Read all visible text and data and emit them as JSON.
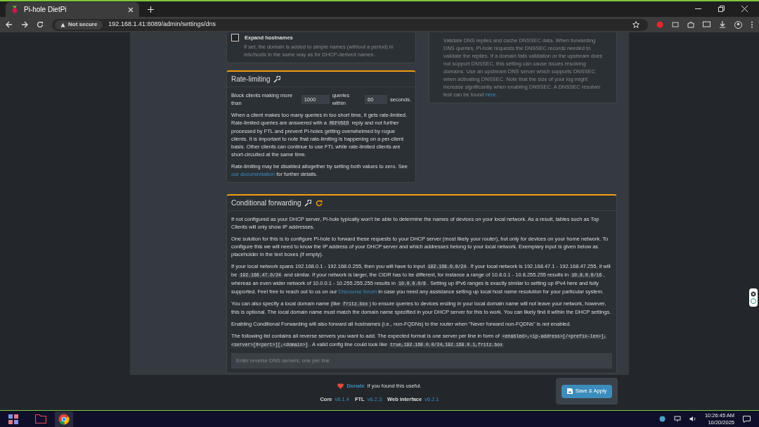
{
  "browser": {
    "tab_title": "Pi-hole DietPi",
    "security_label": "Not secure",
    "url": "192.168.1.41:8089/admin/settings/dns"
  },
  "expand_hostnames": {
    "label": "Expand hostnames",
    "checked": false,
    "help": "If set, the domain is added to simple names (without a period) in /etc/hosts in the same way as for DHCP-derived names."
  },
  "dnssec_help": [
    {
      "kind": "text",
      "text": "Validate DNS replies and cache DNSSEC data. When forwarding DNS queries, Pi-hole requests the DNSSEC records needed to validate the replies. If a domain fails validation or the upstream does not support DNSSEC, this setting can cause issues resolving domains. Use an upstream DNS server which supports DNSSEC when activating DNSSEC. Note that the size of your log might increase significantly when enabling DNSSEC. A DNSSEC resolver test can be found "
    },
    {
      "kind": "link",
      "text": "here"
    },
    {
      "kind": "text",
      "text": "."
    }
  ],
  "rate_limiting": {
    "title": "Rate-limiting",
    "prefix": "Block clients making more than",
    "count": "1000",
    "middle": "queries within",
    "interval": "60",
    "suffix": "seconds.",
    "paragraphs": [
      [
        {
          "kind": "text",
          "text": "When a client makes too many queries in too short time, it gets rate-limited. Rate-limited queries are answered with a "
        },
        {
          "kind": "code",
          "text": "REFUSED"
        },
        {
          "kind": "text",
          "text": " reply and not further processed by FTL and prevent Pi-holes getting overwhelmed by rogue clients. It is important to note that rate-limiting is happening on a per-client basis. Other clients can continue to use FTL while rate-limited clients are short-circuited at the same time."
        }
      ],
      [
        {
          "kind": "text",
          "text": "Rate-limiting may be disabled altogether by setting both values to zero. See "
        },
        {
          "kind": "link",
          "text": "our documentation"
        },
        {
          "kind": "text",
          "text": " for further details."
        }
      ]
    ]
  },
  "conditional_forwarding": {
    "title": "Conditional forwarding",
    "paragraphs": [
      [
        {
          "kind": "text",
          "text": "If not configured as your DHCP server, Pi-hole typically won't be able to determine the names of devices on your local network. As a result, tables such as Top Clients will only show IP addresses."
        }
      ],
      [
        {
          "kind": "text",
          "text": "One solution for this is to configure Pi-hole to forward these requests to your DHCP server (most likely your router), but only for devices on your home network. To configure this we will need to know the IP address of your DHCP server and which addresses belong to your local network. Exemplary input is given below as placeholder in the text boxes (if empty)."
        }
      ],
      [
        {
          "kind": "text",
          "text": "If your local network spans 192.168.0.1 - 192.168.0.255, then you will have to input "
        },
        {
          "kind": "code",
          "text": "192.168.0.0/24"
        },
        {
          "kind": "text",
          "text": ". If your local network is 192.168.47.1 - 192.168.47.255, it will be "
        },
        {
          "kind": "code",
          "text": "192.168.47.0/24"
        },
        {
          "kind": "text",
          "text": " and similar. If your network is larger, the CIDR has to be different, for instance a range of 10.8.0.1 - 10.8.255.255 results in "
        },
        {
          "kind": "code",
          "text": "10.8.0.0/16"
        },
        {
          "kind": "text",
          "text": ", whereas an even wider network of 10.0.0.1 - 10.255.255.255 results in "
        },
        {
          "kind": "code",
          "text": "10.0.0.0/8"
        },
        {
          "kind": "text",
          "text": ". Setting up IPv6 ranges is exactly similar to setting up IPv4 here and fully supported. Feel free to reach out to us on our "
        },
        {
          "kind": "link",
          "text": "Discourse forum"
        },
        {
          "kind": "text",
          "text": " in case you need any assistance setting up local host name resolution for your particular system."
        }
      ],
      [
        {
          "kind": "text",
          "text": "You can also specify a local domain name (like "
        },
        {
          "kind": "code",
          "text": "fritz.box"
        },
        {
          "kind": "text",
          "text": ") to ensure queries to devices ending in your local domain name will not leave your network, however, this is optional. The local domain name must match the domain name specified in your DHCP server for this to work. You can likely find it within the DHCP settings."
        }
      ],
      [
        {
          "kind": "text",
          "text": "Enabling Conditional Forwarding will also forward all hostnames (i.e., non-FQDNs) to the router when \"Never forward non-FQDNs\" is *not* enabled."
        }
      ],
      [
        {
          "kind": "text",
          "text": "The following list contains all reverse servers you want to add. The expected format is one server per line in form of "
        },
        {
          "kind": "code",
          "text": "<enabled>,<ip-address>[/<prefix-len>],<server>[#<port>][,<domain>]"
        },
        {
          "kind": "text",
          "text": ". A valid config line could look like "
        },
        {
          "kind": "code",
          "text": "true,192.168.0.0/24,192.168.0.1,fritz.box"
        }
      ]
    ],
    "placeholder": "Enter reverse DNS servers, one per line"
  },
  "footer": {
    "donate_link": "Donate",
    "donate_text": "if you found this useful.",
    "versions": [
      {
        "label": "Core",
        "version": "v6.1.4"
      },
      {
        "label": "FTL",
        "version": "v6.2.3"
      },
      {
        "label": "Web interface",
        "version": "v6.2.1"
      }
    ]
  },
  "save_button": "Save & Apply",
  "taskbar": {
    "time": "10:26:45 AM",
    "date": "10/20/2025"
  }
}
